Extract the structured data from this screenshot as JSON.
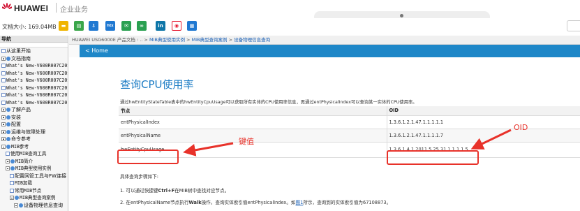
{
  "header": {
    "brand": "HUAWEI",
    "subtitle": "企业业务"
  },
  "toolbar": {
    "doc_size": "文档大小: 169.04MB"
  },
  "nav": {
    "title": "导航",
    "items": [
      {
        "label": "从这里开始",
        "icon": "page-icon"
      },
      {
        "label": "文档指南",
        "icon": "plus-icon"
      },
      {
        "label": "What's New-V600R007C20S",
        "icon": "page-icon"
      },
      {
        "label": "What's New-V600R007C20S",
        "icon": "page-icon"
      },
      {
        "label": "What's New-V600R007C20S",
        "icon": "page-icon"
      },
      {
        "label": "What's New-V600R007C20S",
        "icon": "page-icon"
      },
      {
        "label": "What's New-V600R007C20S",
        "icon": "page-icon"
      },
      {
        "label": "What's New-V600R007C20",
        "icon": "page-icon"
      },
      {
        "label": "了解产品",
        "icon": "plus-icon"
      },
      {
        "label": "安装",
        "icon": "plus-icon"
      },
      {
        "label": "配置",
        "icon": "plus-icon"
      },
      {
        "label": "运维与故障处理",
        "icon": "plus-icon"
      },
      {
        "label": "命令参考",
        "icon": "plus-icon"
      },
      {
        "label": "MIB参考",
        "icon": "minus-icon"
      },
      {
        "label": "使用MIB查询工具",
        "icon": "page-icon"
      },
      {
        "label": "MIB简介",
        "icon": "plus-icon"
      },
      {
        "label": "MIB典型使用实例",
        "icon": "minus-icon"
      },
      {
        "label": "配置网管工具与FW连接",
        "icon": "page-icon"
      },
      {
        "label": "MIB加载",
        "icon": "page-icon"
      },
      {
        "label": "常用MIB节点",
        "icon": "page-icon"
      },
      {
        "label": "MIB典型查询案例",
        "icon": "minus-icon"
      },
      {
        "label": "设备物理信息查询",
        "icon": "minus-icon"
      }
    ]
  },
  "breadcrumb": {
    "product": "HUAWEI USG6000E 产品文档",
    "sep1": " : ..",
    "item1": "MIB典型使用实例",
    "item2": "MIB典型查询案例",
    "item3": "设备物理信息查询",
    "arrow": " > "
  },
  "home_link": "< Home",
  "page": {
    "title": "查询CPU使用率",
    "intro": "通过hwEntityStateTable表中的hwEntityCpuUsage可以获取所有实体的CPU使用率信息，再通过entPhysicalIndex可以查询某一实体的CPU使用率。",
    "table": {
      "headers": [
        "节点",
        "OID"
      ],
      "rows": [
        [
          "entPhysicalIndex",
          "1.3.6.1.2.1.47.1.1.1.1.1"
        ],
        [
          "entPhysicalName",
          "1.3.6.1.2.1.47.1.1.1.1.7"
        ],
        [
          "hwEntityCpuUsage",
          "1.3.6.1.4.1.2011.5.25.31.1.1.1.1.5"
        ]
      ]
    },
    "steps_title": "具体查询步骤如下:",
    "step1_pre": "1. 可以通过快捷键",
    "step1_key": "Ctrl+F",
    "step1_post": "在MIB树中查找对应节点。",
    "step2_pre": "2. 在entPhysicalName节点执行",
    "step2_op": "Walk",
    "step2_mid": "操作，查询实体索引值entPhysicalIndex。如",
    "step2_link": "图1",
    "step2_post": "所示，查询到的实体索引值为67108873。"
  },
  "annotations": {
    "key_label": "键值",
    "oid_label": "OID",
    "color": "#e8322a"
  },
  "colors": {
    "title_blue": "#1a7bc4",
    "home_bar": "#1e87c8",
    "brand_red": "#cf0a2c"
  }
}
